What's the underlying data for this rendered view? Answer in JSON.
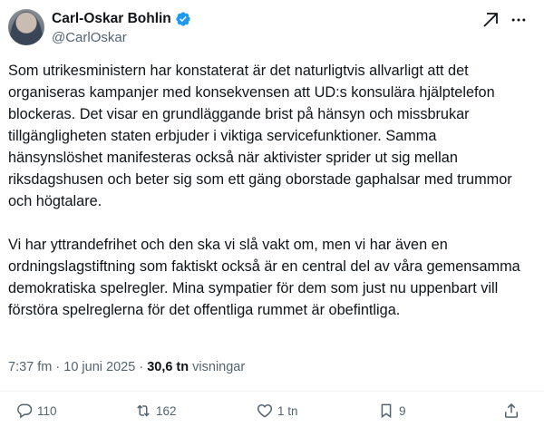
{
  "author": {
    "name": "Carl-Oskar Bohlin",
    "handle": "@CarlOskar"
  },
  "post": {
    "paragraphs": [
      "Som utrikesministern har konstaterat är det naturligtvis allvarligt att det organiseras kampanjer med konsekvensen att UD:s konsulära hjälptelefon blockeras. Det visar en grundläggande brist på hänsyn och missbrukar tillgängligheten staten erbjuder i viktiga servicefunktioner. Samma hänsynslöshet manifesteras också när aktivister sprider ut sig mellan riksdagshusen och beter sig som ett gäng oborstade gaphalsar med trummor och högtalare.",
      "Vi har yttrandefrihet och den ska vi slå vakt om, men vi har även en ordningslagstiftning som faktiskt också är en central del av våra gemensamma demokratiska spelregler. Mina sympatier för dem som just nu uppenbart vill förstöra spelreglerna för det offentliga rummet är obefintliga."
    ],
    "time": "7:37 fm",
    "separator": "·",
    "date": "10 juni 2025",
    "views_count": "30,6 tn",
    "views_label": "visningar"
  },
  "actions": {
    "replies": "110",
    "reposts": "162",
    "likes": "1 tn",
    "bookmarks": "9"
  },
  "colors": {
    "verified": "#1d9bf0",
    "secondary_text": "#536471",
    "primary_text": "#0f1419"
  },
  "icons": [
    "verified-badge-icon",
    "grok-icon",
    "more-icon",
    "reply-icon",
    "repost-icon",
    "like-icon",
    "bookmark-icon",
    "share-icon"
  ]
}
